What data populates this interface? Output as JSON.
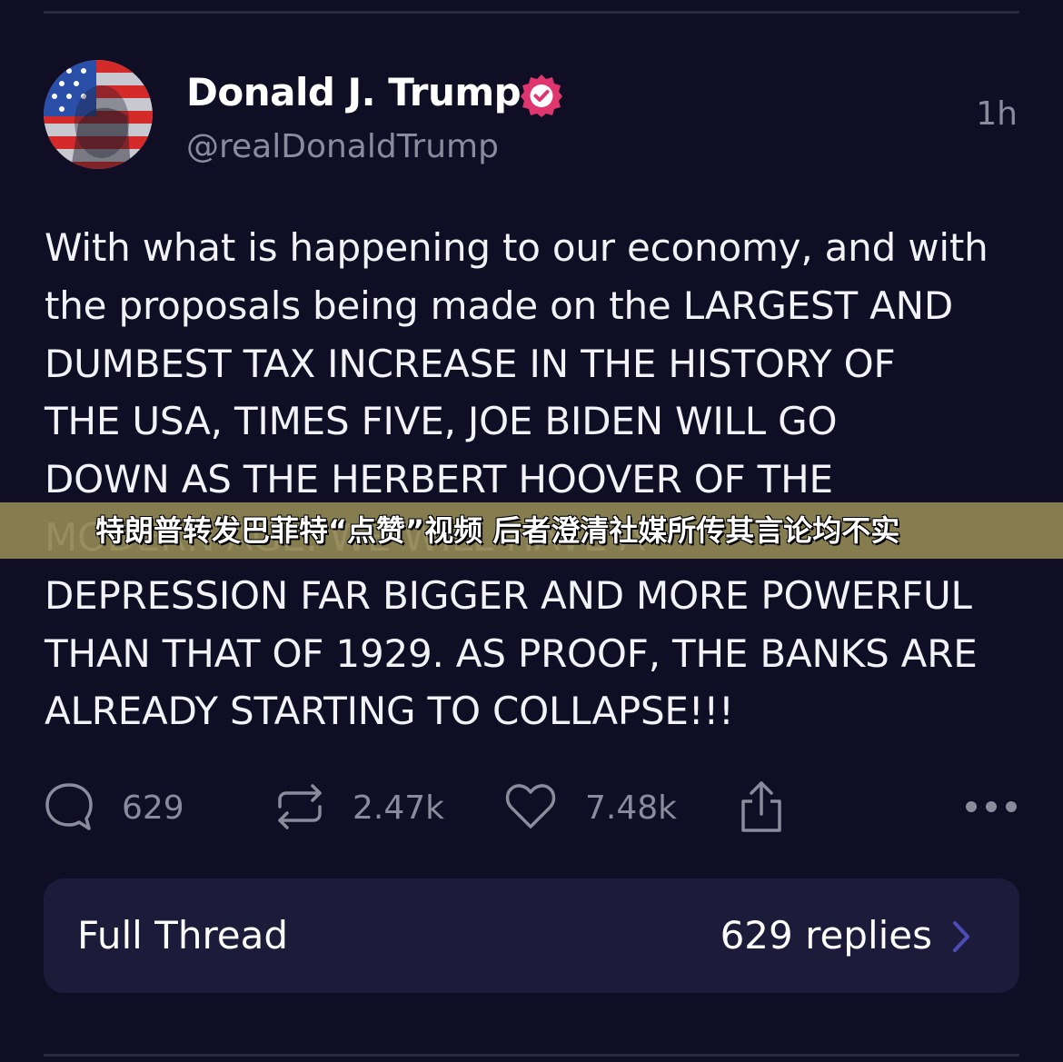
{
  "post": {
    "author": {
      "name": "Donald J. Trump",
      "handle": "@realDonaldTrump",
      "verified": true,
      "avatar": "flag-painted-face-avatar"
    },
    "timestamp": "1h",
    "body": "With what is happening to our economy, and with\nthe proposals being made on the LARGEST AND\nDUMBEST TAX INCREASE IN THE HISTORY OF\nTHE USA, TIMES FIVE, JOE BIDEN WILL GO\nDOWN AS THE HERBERT HOOVER OF THE\nMODERN AGE. WE WILL HAVE A\nDEPRESSION FAR BIGGER AND MORE POWERFUL\nTHAN THAT OF 1929. AS PROOF, THE BANKS ARE\nALREADY STARTING TO COLLAPSE!!!",
    "actions": {
      "replies": "629",
      "reposts": "2.47k",
      "likes": "7.48k"
    },
    "thread": {
      "label": "Full Thread",
      "replies": "629 replies"
    }
  },
  "overlay": {
    "caption": "特朗普转发巴菲特“点赞”视频 后者澄清社媒所传其言论均不实"
  },
  "colors": {
    "background": "#0f0e24",
    "card": "#1c1b3a",
    "muted": "#8a8b9c",
    "verified_badge": "#e0366e",
    "banner": "#8e8454"
  },
  "icons": [
    "reply-icon",
    "repost-icon",
    "like-icon",
    "share-icon",
    "more-icon",
    "verified-badge-icon",
    "chevron-right-icon"
  ]
}
